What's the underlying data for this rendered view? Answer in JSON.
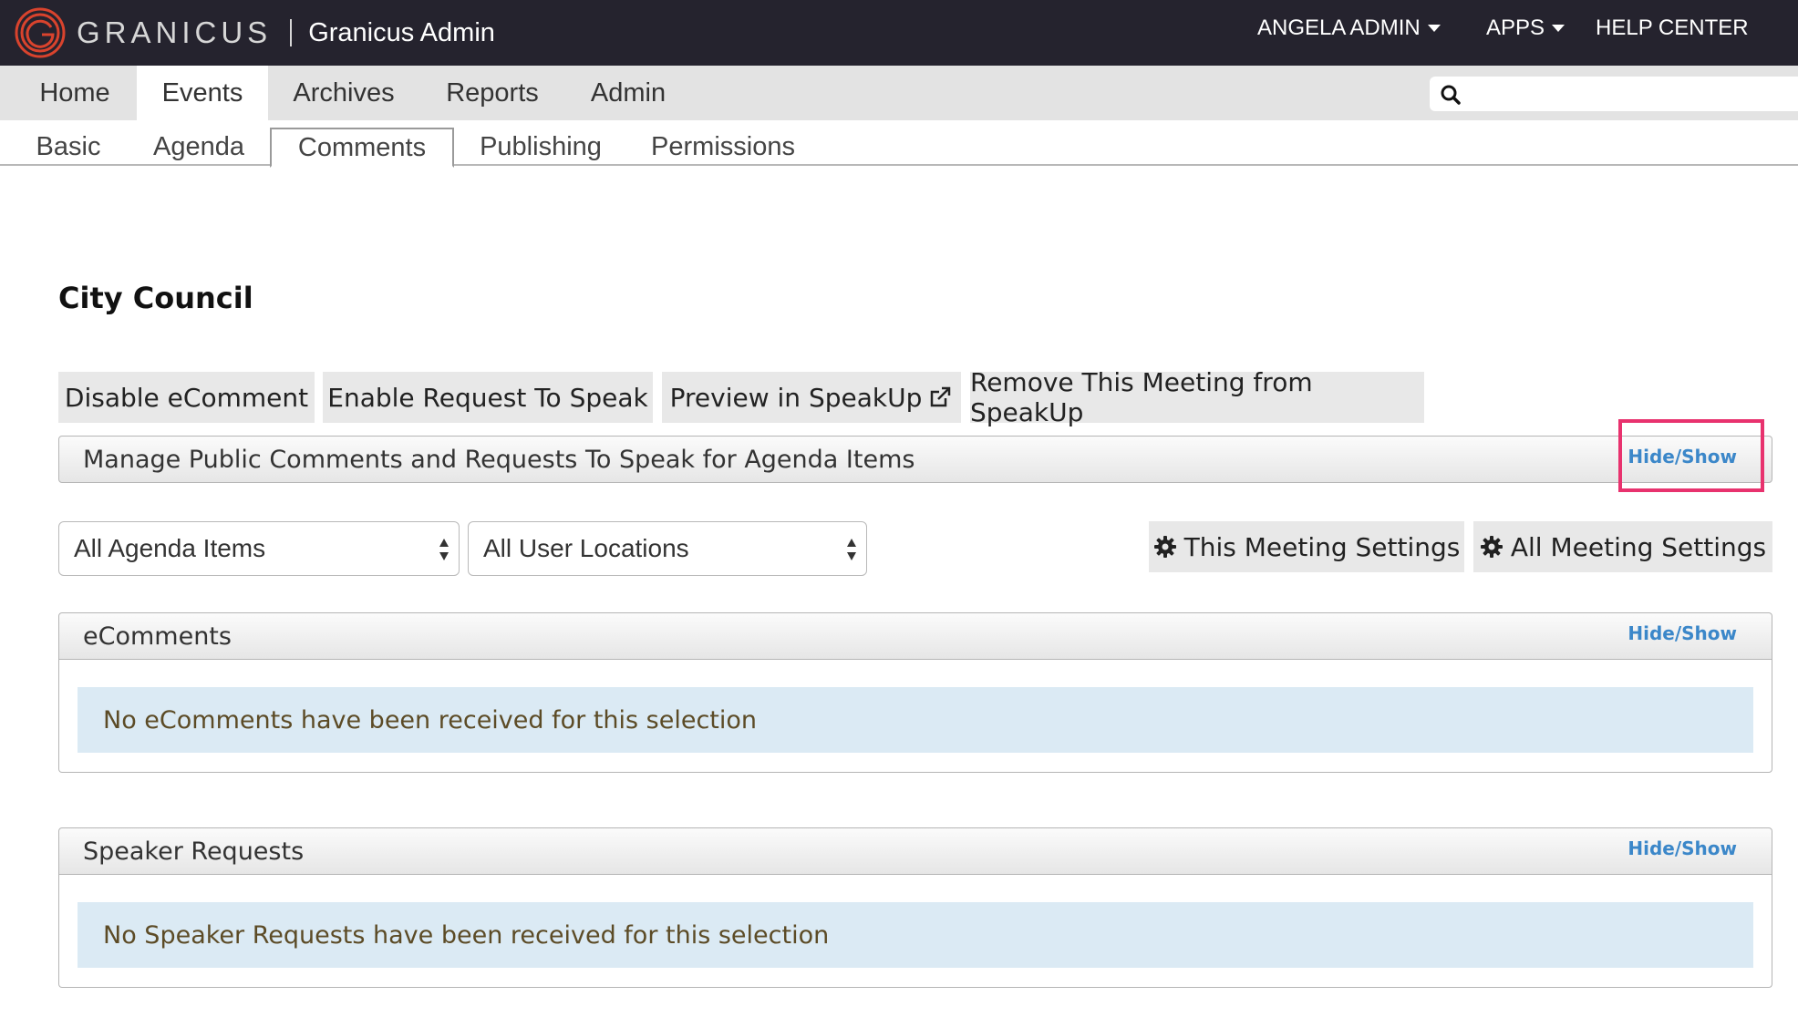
{
  "topbar": {
    "logo_text": "GRANICUS",
    "app_name": "Granicus Admin",
    "user_menu": "ANGELA ADMIN",
    "apps_menu": "APPS",
    "help": "HELP CENTER"
  },
  "main_nav": [
    "Home",
    "Events",
    "Archives",
    "Reports",
    "Admin"
  ],
  "main_nav_active": "Events",
  "search": {
    "placeholder": ""
  },
  "sub_nav": [
    "Basic",
    "Agenda",
    "Comments",
    "Publishing",
    "Permissions"
  ],
  "sub_nav_active": "Comments",
  "page_title": "City Council",
  "actions": {
    "disable_ecomment": "Disable eComment",
    "enable_request": "Enable Request To Speak",
    "preview": "Preview in SpeakUp",
    "remove": "Remove This Meeting from SpeakUp"
  },
  "manage_panel": {
    "title": "Manage Public Comments and Requests To Speak for Agenda Items",
    "toggle": "Hide/Show"
  },
  "filters": {
    "agenda_items": "All Agenda Items",
    "user_locations": "All User Locations"
  },
  "settings": {
    "this_meeting": "This Meeting Settings",
    "all_meeting": "All Meeting Settings"
  },
  "ecomments_panel": {
    "title": "eComments",
    "toggle": "Hide/Show",
    "message": "No eComments have been received for this selection"
  },
  "speaker_panel": {
    "title": "Speaker Requests",
    "toggle": "Hide/Show",
    "message": "No Speaker Requests have been received for this selection"
  },
  "colors": {
    "topbar": "#25232e",
    "nav": "#e3e3e3",
    "link": "#3b87c9",
    "alert_bg": "#dbeaf4",
    "highlight": "#e8326e"
  },
  "icons": [
    "granicus-logo-icon",
    "caret-down-icon",
    "search-icon",
    "external-link-icon",
    "gear-icon",
    "select-arrows-icon"
  ]
}
